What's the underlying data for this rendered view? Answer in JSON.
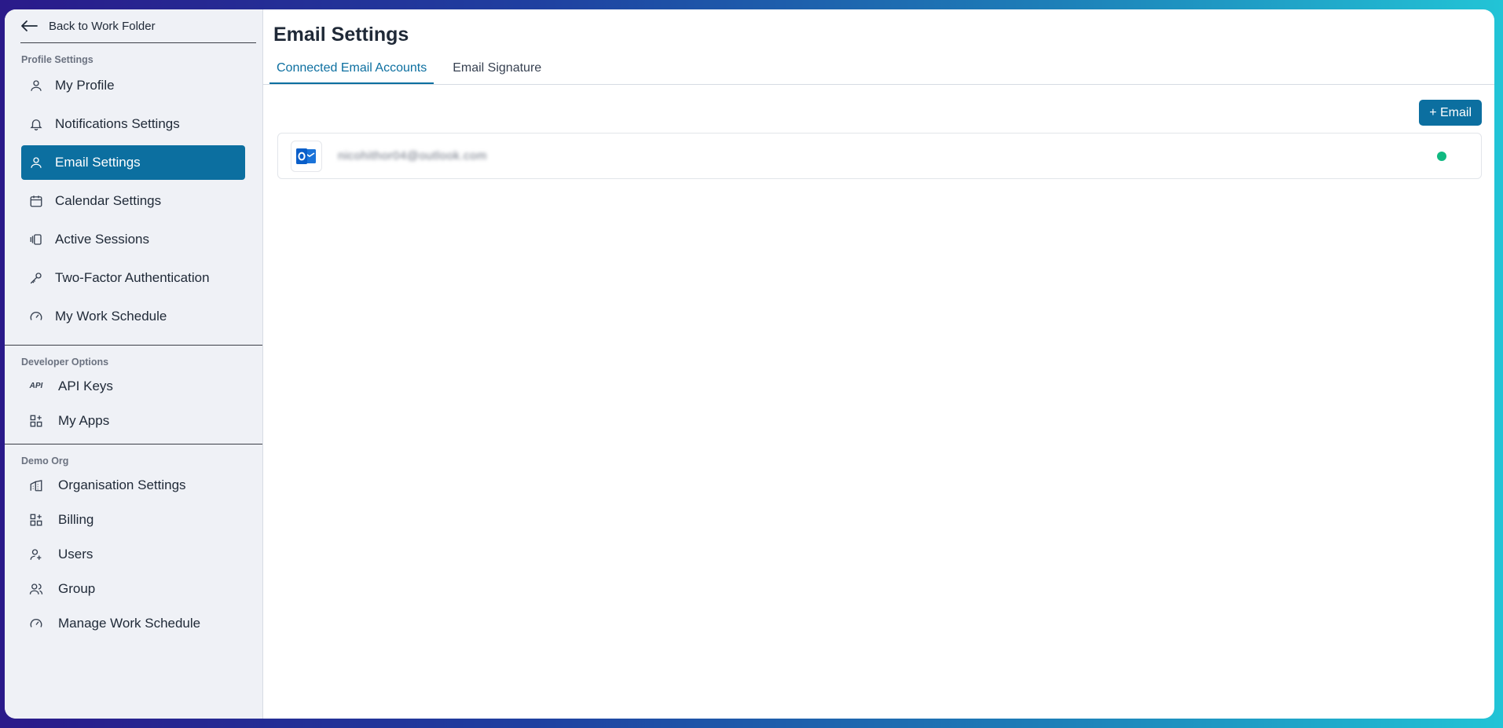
{
  "sidebar": {
    "back_label": "Back to Work Folder",
    "sections": [
      {
        "title": "Profile Settings",
        "items": [
          {
            "label": "My Profile",
            "icon": "user-icon"
          },
          {
            "label": "Notifications Settings",
            "icon": "bell-icon"
          },
          {
            "label": "Email Settings",
            "icon": "user-icon",
            "active": true
          },
          {
            "label": "Calendar Settings",
            "icon": "calendar-icon"
          },
          {
            "label": "Active Sessions",
            "icon": "sessions-icon"
          },
          {
            "label": "Two-Factor Authentication",
            "icon": "key-icon"
          },
          {
            "label": "My Work Schedule",
            "icon": "gauge-icon"
          }
        ]
      },
      {
        "title": "Developer Options",
        "items": [
          {
            "label": "API Keys",
            "icon": "api-icon"
          },
          {
            "label": "My Apps",
            "icon": "apps-grid-icon"
          }
        ]
      },
      {
        "title": "Demo Org",
        "items": [
          {
            "label": "Organisation Settings",
            "icon": "building-icon"
          },
          {
            "label": "Billing",
            "icon": "apps-grid-icon"
          },
          {
            "label": "Users",
            "icon": "user-plus-icon"
          },
          {
            "label": "Group",
            "icon": "users-icon"
          },
          {
            "label": "Manage Work Schedule",
            "icon": "gauge-icon"
          }
        ]
      }
    ]
  },
  "main": {
    "title": "Email Settings",
    "tabs": [
      {
        "label": "Connected Email Accounts",
        "active": true
      },
      {
        "label": "Email Signature",
        "active": false
      }
    ],
    "add_email_label": "+ Email",
    "accounts": [
      {
        "email": "nicohithor04@outlook.com",
        "provider_icon": "outlook-icon",
        "status": "connected"
      }
    ]
  },
  "colors": {
    "accent": "#0c6fa0",
    "status_connected": "#10b981",
    "sidebar_bg": "#eff1f6"
  }
}
